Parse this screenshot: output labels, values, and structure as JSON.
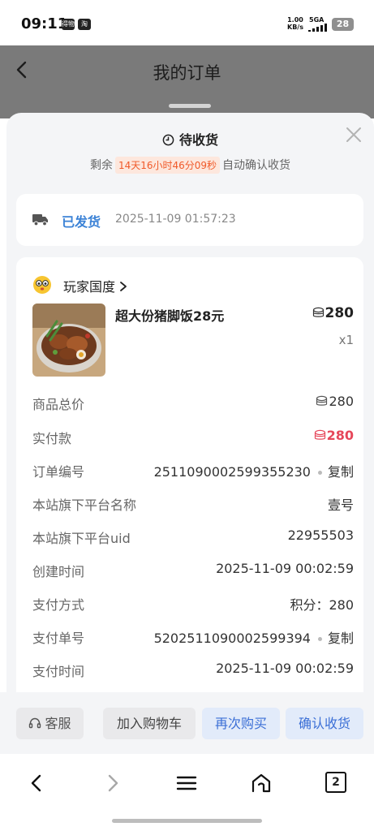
{
  "status_bar": {
    "time": "09:11",
    "app_icons": [
      "得物",
      "淘"
    ],
    "net_speed_value": "1.00",
    "net_speed_unit": "KB/s",
    "network": "5GA",
    "battery": "28"
  },
  "header": {
    "title": "我的订单"
  },
  "sheet": {
    "status_title": "待收货",
    "countdown_prefix": "剩余",
    "countdown": "14天16小时46分09秒",
    "countdown_suffix": "自动确认收货"
  },
  "shipping": {
    "status": "已发货",
    "time": "2025-11-09 01:57:23"
  },
  "order": {
    "shop_name": "玩家国度",
    "product_title": "超大份猪脚饭28元",
    "price": "280",
    "quantity": "x1",
    "details": [
      {
        "label": "商品总价",
        "value": "280"
      },
      {
        "label": "实付款",
        "value": "280"
      },
      {
        "label": "订单编号",
        "value": "2511090002599355230",
        "action": "复制"
      },
      {
        "label": "本站旗下平台名称",
        "value": "壹号"
      },
      {
        "label": "本站旗下平台uid",
        "value": "22955503"
      },
      {
        "label": "创建时间",
        "value": "2025-11-09 00:02:59"
      },
      {
        "label": "支付方式",
        "value": "积分：280"
      },
      {
        "label": "支付单号",
        "value": "5202511090002599394",
        "action": "复制"
      },
      {
        "label": "支付时间",
        "value": "2025-11-09 00:02:59"
      }
    ]
  },
  "actions": {
    "service": "客服",
    "add_cart": "加入购物车",
    "rebuy": "再次购买",
    "confirm": "确认收货"
  },
  "browser_nav": {
    "tab_count": "2"
  },
  "colors": {
    "accent_blue": "#3b82d6",
    "price_red": "#e6475a",
    "countdown_orange": "#f05a2a"
  },
  "icons": [
    "back-icon",
    "clock-icon",
    "close-icon",
    "truck-icon",
    "coin-icon",
    "headset-icon",
    "chevron-right-icon",
    "home-icon",
    "menu-icon",
    "tabs-icon"
  ]
}
